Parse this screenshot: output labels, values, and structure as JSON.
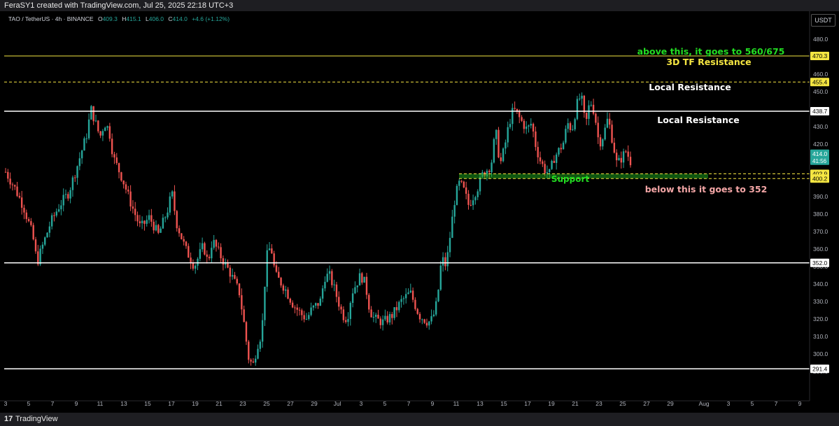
{
  "header": {
    "caption": "FeraSY1 created with TradingView.com, Jul 25, 2025 22:18 UTC+3"
  },
  "legend": {
    "symbol": "TAO / TetherUS · 4h · BINANCE",
    "open_label": "O",
    "open": "409.3",
    "high_label": "H",
    "high": "415.1",
    "low_label": "L",
    "low": "406.0",
    "close_label": "C",
    "close": "414.0",
    "change": "+4.6 (+1.12%)"
  },
  "price_scale": {
    "currency": "USDT",
    "ticks": [
      "480.0",
      "470.0",
      "460.0",
      "450.0",
      "440.0",
      "430.0",
      "420.0",
      "410.0",
      "400.0",
      "390.0",
      "380.0",
      "370.0",
      "360.0",
      "350.0",
      "340.0",
      "330.0",
      "320.0",
      "310.0",
      "300.0",
      "290.0"
    ],
    "current_price": "414.0",
    "countdown": "41:56"
  },
  "footer": {
    "logo": "17",
    "brand": "TradingView"
  },
  "colors": {
    "up": "#26a69a",
    "down": "#ef5350",
    "support_zone": "#1e9e1e",
    "support_text": "#22dd22",
    "annotation_green": "#22dd22",
    "annotation_yellow": "#f5e642",
    "annotation_pink": "#f4a6a6",
    "white_line": "#ffffff",
    "yellow_line": "#f5e642"
  },
  "chart_data": {
    "type": "candlestick",
    "symbol": "TAO / TetherUS",
    "interval": "4h",
    "exchange": "BINANCE",
    "ylim": [
      284,
      490
    ],
    "x_ticks": [
      "3",
      "5",
      "7",
      "9",
      "11",
      "13",
      "15",
      "17",
      "19",
      "21",
      "23",
      "25",
      "27",
      "29",
      "Jul",
      "3",
      "5",
      "7",
      "9",
      "11",
      "13",
      "15",
      "17",
      "19",
      "21",
      "23",
      "25",
      "27",
      "29",
      "Aug",
      "3",
      "5",
      "7",
      "9"
    ],
    "grid": false,
    "levels": [
      {
        "price": 470.3,
        "label": "470.3",
        "style": "solid",
        "color": "yellow"
      },
      {
        "price": 455.4,
        "label": "455.4",
        "style": "dashed",
        "color": "yellow"
      },
      {
        "price": 438.7,
        "label": "438.7",
        "style": "solid",
        "color": "white"
      },
      {
        "price": 402.9,
        "label": "402.9",
        "style": "dashed",
        "color": "yellow"
      },
      {
        "price": 400.2,
        "label": "400.2",
        "style": "dashed",
        "color": "yellow"
      },
      {
        "price": 352.0,
        "label": "352.0",
        "style": "solid",
        "color": "white"
      },
      {
        "price": 291.4,
        "label": "291.4",
        "style": "solid",
        "color": "white"
      }
    ],
    "annotations": [
      {
        "text": "above this, it goes to 560/675",
        "color": "green"
      },
      {
        "text": "3D TF Resistance",
        "color": "yellow"
      },
      {
        "text": "Local Resistance",
        "color": "white"
      },
      {
        "text": "Local Resistance",
        "color": "white"
      },
      {
        "text": "Support",
        "color": "green"
      },
      {
        "text": "below this it goes to 352",
        "color": "pink"
      }
    ],
    "price_path": [
      [
        0,
        404
      ],
      [
        2,
        395
      ],
      [
        4,
        384
      ],
      [
        6,
        368
      ],
      [
        7,
        352
      ],
      [
        8,
        360
      ],
      [
        10,
        375
      ],
      [
        12,
        385
      ],
      [
        14,
        392
      ],
      [
        16,
        408
      ],
      [
        18,
        425
      ],
      [
        19,
        440
      ],
      [
        20,
        432
      ],
      [
        21,
        424
      ],
      [
        22,
        432
      ],
      [
        23,
        428
      ],
      [
        24,
        412
      ],
      [
        26,
        400
      ],
      [
        28,
        385
      ],
      [
        30,
        372
      ],
      [
        32,
        378
      ],
      [
        34,
        368
      ],
      [
        36,
        382
      ],
      [
        37,
        392
      ],
      [
        38,
        375
      ],
      [
        40,
        360
      ],
      [
        42,
        350
      ],
      [
        44,
        362
      ],
      [
        45,
        352
      ],
      [
        46,
        365
      ],
      [
        48,
        355
      ],
      [
        50,
        346
      ],
      [
        52,
        335
      ],
      [
        53,
        318
      ],
      [
        54,
        298
      ],
      [
        55,
        293
      ],
      [
        56,
        305
      ],
      [
        57,
        312
      ],
      [
        58,
        355
      ],
      [
        59,
        362
      ],
      [
        60,
        345
      ],
      [
        62,
        338
      ],
      [
        64,
        328
      ],
      [
        66,
        322
      ],
      [
        67,
        320
      ],
      [
        68,
        325
      ],
      [
        70,
        330
      ],
      [
        71,
        344
      ],
      [
        72,
        345
      ],
      [
        73,
        338
      ],
      [
        74,
        330
      ],
      [
        75,
        322
      ],
      [
        76,
        320
      ],
      [
        77,
        335
      ],
      [
        78,
        340
      ],
      [
        79,
        345
      ],
      [
        80,
        340
      ],
      [
        81,
        325
      ],
      [
        82,
        320
      ],
      [
        84,
        318
      ],
      [
        86,
        322
      ],
      [
        88,
        330
      ],
      [
        90,
        335
      ],
      [
        92,
        322
      ],
      [
        93,
        320
      ],
      [
        94,
        318
      ],
      [
        95,
        320
      ],
      [
        96,
        330
      ],
      [
        97,
        355
      ],
      [
        98,
        350
      ],
      [
        99,
        370
      ],
      [
        100,
        390
      ],
      [
        101,
        398
      ],
      [
        102,
        393
      ],
      [
        103,
        385
      ],
      [
        104,
        390
      ],
      [
        105,
        395
      ],
      [
        106,
        402
      ],
      [
        108,
        408
      ],
      [
        109,
        428
      ],
      [
        110,
        408
      ],
      [
        111,
        418
      ],
      [
        112,
        432
      ],
      [
        113,
        440
      ],
      [
        114,
        436
      ],
      [
        116,
        428
      ],
      [
        117,
        432
      ],
      [
        118,
        418
      ],
      [
        119,
        410
      ],
      [
        120,
        405
      ],
      [
        121,
        403
      ],
      [
        122,
        412
      ],
      [
        124,
        420
      ],
      [
        125,
        432
      ],
      [
        126,
        428
      ],
      [
        127,
        442
      ],
      [
        128,
        448
      ],
      [
        129,
        430
      ],
      [
        130,
        445
      ],
      [
        131,
        438
      ],
      [
        132,
        420
      ],
      [
        133,
        425
      ],
      [
        134,
        435
      ],
      [
        135,
        422
      ],
      [
        136,
        408
      ],
      [
        137,
        412
      ],
      [
        138,
        416
      ],
      [
        139,
        410
      ]
    ],
    "current": {
      "open": 409.3,
      "high": 415.1,
      "low": 406.0,
      "close": 414.0,
      "change": 4.6,
      "change_pct": 1.12
    }
  }
}
